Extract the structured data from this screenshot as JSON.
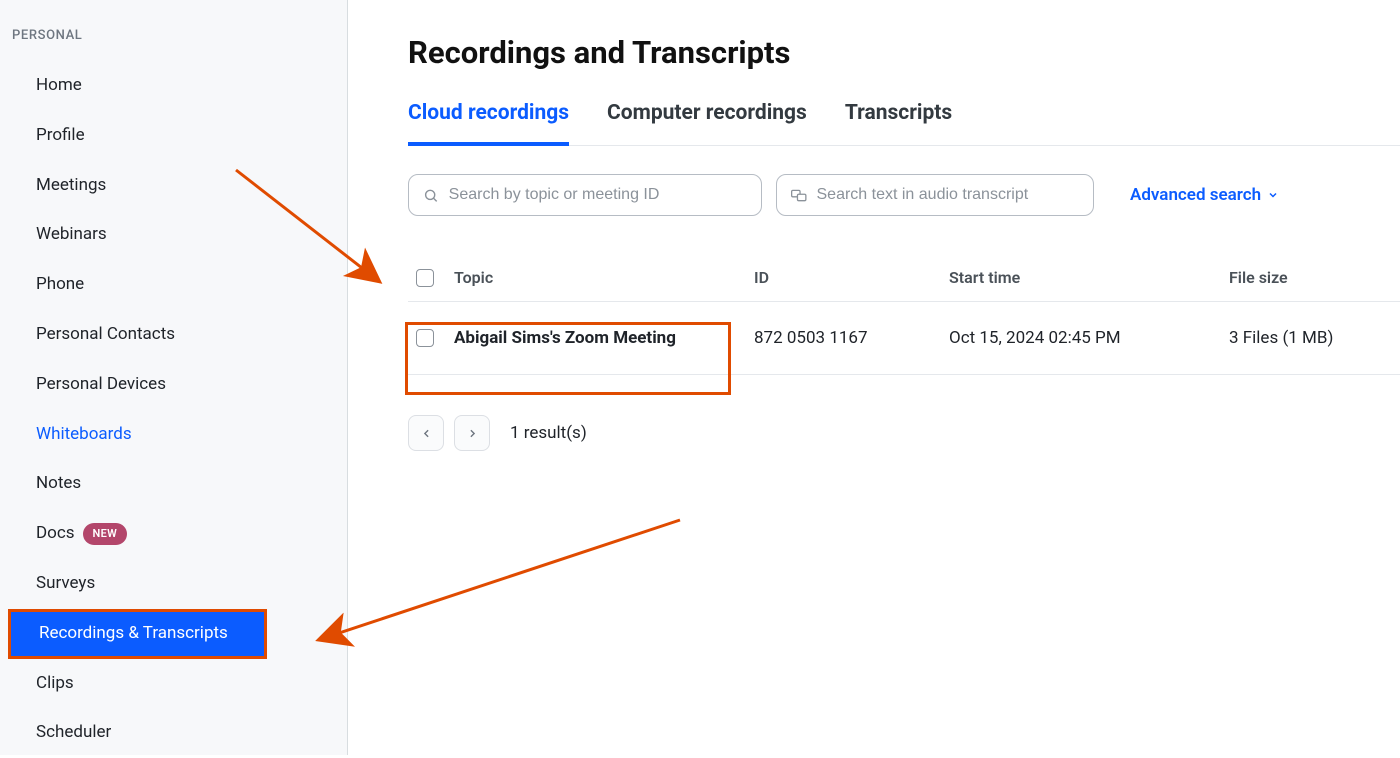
{
  "sidebar": {
    "section_label": "PERSONAL",
    "items": [
      {
        "label": "Home"
      },
      {
        "label": "Profile"
      },
      {
        "label": "Meetings"
      },
      {
        "label": "Webinars"
      },
      {
        "label": "Phone"
      },
      {
        "label": "Personal Contacts"
      },
      {
        "label": "Personal Devices"
      },
      {
        "label": "Whiteboards",
        "link": true
      },
      {
        "label": "Notes"
      },
      {
        "label": "Docs",
        "badge": "NEW"
      },
      {
        "label": "Surveys"
      },
      {
        "label": "Recordings & Transcripts",
        "selected": true
      },
      {
        "label": "Clips"
      },
      {
        "label": "Scheduler"
      }
    ]
  },
  "main": {
    "title": "Recordings and Transcripts",
    "tabs": [
      {
        "label": "Cloud recordings",
        "active": true
      },
      {
        "label": "Computer recordings"
      },
      {
        "label": "Transcripts"
      }
    ],
    "search": {
      "topic_placeholder": "Search by topic or meeting ID",
      "transcript_placeholder": "Search text in audio transcript",
      "advanced_label": "Advanced search"
    },
    "table": {
      "headers": {
        "topic": "Topic",
        "id": "ID",
        "start": "Start time",
        "size": "File size"
      },
      "rows": [
        {
          "topic": "Abigail Sims's Zoom Meeting",
          "id": "872 0503 1167",
          "start": "Oct 15, 2024 02:45 PM",
          "size": "3 Files (1 MB)"
        }
      ]
    },
    "pager": {
      "results": "1 result(s)"
    }
  },
  "colors": {
    "accent": "#0b5cff",
    "annotation": "#e04b00"
  }
}
